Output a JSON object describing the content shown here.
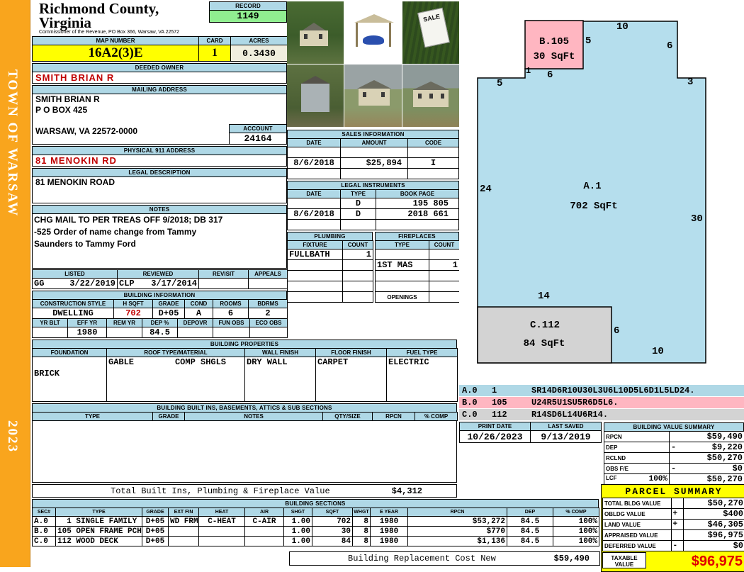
{
  "colors": {
    "accent_blue": "#AFD8E6",
    "record_green": "#90EE90",
    "highlight_yellow": "#FFFF00",
    "alert_red": "#C00000",
    "sidebar_orange": "#F9A51D",
    "sketch_blue": "#B5DEED",
    "sketch_pink": "#FFB6C1",
    "sketch_gray": "#D3D3D3"
  },
  "sidebar": {
    "title": "TOWN OF WARSAW",
    "year": "2023"
  },
  "header": {
    "county": "Richmond County, Virginia",
    "subtitle": "Commissioner of the Revenue, PO Box 366, Warsaw, VA 22572",
    "record_label": "RECORD",
    "record_value": "1149",
    "map_label": "MAP NUMBER",
    "map_value": "16A2(3)E",
    "card_label": "CARD",
    "card_value": "1",
    "acres_label": "ACRES",
    "acres_value": "0.3430"
  },
  "photos": {
    "items": [
      "house-street-view",
      "carport",
      "for-sale-sign",
      "shed",
      "house-front",
      "house-side"
    ],
    "sign_text": "SALE"
  },
  "owner": {
    "deeded_label": "DEEDED OWNER",
    "deeded": "SMITH BRIAN R",
    "mailing_label": "MAILING ADDRESS",
    "mailing_lines": [
      "SMITH BRIAN R",
      "P O BOX 425",
      "",
      "WARSAW, VA 22572-0000"
    ],
    "account_label": "ACCOUNT",
    "account": "24164",
    "physical_label": "PHYSICAL 911 ADDRESS",
    "physical": "81 MENOKIN RD",
    "legal_label": "LEGAL DESCRIPTION",
    "legal": "81 MENOKIN ROAD",
    "notes_label": "NOTES",
    "notes_lines": [
      "CHG MAIL TO PER TREAS OFF 9/2018; DB 317",
      "-525 Order of name change from Tammy",
      "Saunders to Tammy Ford"
    ]
  },
  "review": {
    "columns": [
      "LISTED",
      "REVIEWED",
      "REVISIT",
      "APPEALS"
    ],
    "listed_by": "GG",
    "listed_date": "3/22/2019",
    "reviewed_by": "CLP",
    "reviewed_date": "3/17/2014",
    "revisit": "",
    "appeals": ""
  },
  "building_information": {
    "title": "BUILDING INFORMATION",
    "row1_columns": [
      "CONSTRUCTION STYLE",
      "H SQFT",
      "GRADE",
      "COND",
      "ROOMS",
      "BDRMS"
    ],
    "row1_values": [
      "DWELLING",
      "702",
      "D+05",
      "A",
      "6",
      "2"
    ],
    "row2_columns": [
      "YR BLT",
      "EFF YR",
      "REM YR",
      "DEP %",
      "DEPOVR",
      "FUN OBS",
      "ECO OBS"
    ],
    "row2_values": [
      "",
      "1980",
      "",
      "84.5",
      "",
      "",
      ""
    ]
  },
  "building_properties": {
    "title": "BUILDING PROPERTIES",
    "columns": [
      "FOUNDATION",
      "ROOF TYPE/MATERIAL",
      "WALL FINISH",
      "FLOOR FINISH",
      "FUEL TYPE"
    ],
    "foundation": "BRICK",
    "roof_type": "GABLE",
    "roof_material": "COMP SHGLS",
    "wall_finish": "DRY WALL",
    "floor_finish": "CARPET",
    "fuel_type": "ELECTRIC"
  },
  "built_ins": {
    "title": "BUILDING BUILT INS, BASEMENTS, ATTICS & SUB SECTIONS",
    "columns": [
      "TYPE",
      "GRADE",
      "NOTES",
      "QTY/SIZE",
      "RPCN",
      "% COMP"
    ],
    "total_label": "Total Built Ins, Plumbing & Fireplace Value",
    "total_value": "$4,312"
  },
  "sales": {
    "title": "SALES INFORMATION",
    "columns": [
      "DATE",
      "AMOUNT",
      "CODE"
    ],
    "rows": [
      [
        "",
        "",
        ""
      ],
      [
        "8/6/2018",
        "$25,894",
        "I"
      ],
      [
        "",
        "",
        ""
      ]
    ]
  },
  "legal_instruments": {
    "title": "LEGAL INSTRUMENTS",
    "columns": [
      "DATE",
      "TYPE",
      "BOOK PAGE"
    ],
    "rows": [
      [
        "",
        "D",
        "195 805"
      ],
      [
        "8/6/2018",
        "D",
        "2018 661"
      ],
      [
        "",
        "",
        ""
      ]
    ]
  },
  "plumbing": {
    "title": "PLUMBING",
    "columns": [
      "FIXTURE",
      "COUNT"
    ],
    "rows": [
      [
        "FULLBATH",
        "1"
      ],
      [
        "",
        ""
      ],
      [
        "",
        ""
      ],
      [
        "",
        ""
      ],
      [
        "",
        ""
      ]
    ]
  },
  "fireplaces": {
    "title": "FIREPLACES",
    "columns": [
      "TYPE",
      "COUNT"
    ],
    "rows": [
      [
        "",
        ""
      ],
      [
        "1ST MAS",
        "1"
      ],
      [
        "",
        ""
      ],
      [
        "",
        ""
      ]
    ],
    "openings_label": "OPENINGS",
    "openings_value": ""
  },
  "sketch": {
    "areas": {
      "a_id": "A.1",
      "a_size": "702 SqFt",
      "b_id": "B.105",
      "b_size": "30 SqFt",
      "c_id": "C.112",
      "c_size": "84 SqFt"
    },
    "dims": [
      "10",
      "6",
      "5",
      "3",
      "5",
      "1",
      "6",
      "24",
      "30",
      "14",
      "6",
      "10"
    ],
    "legend": [
      {
        "sec": "A.0",
        "num": "1",
        "code": "SR14D6R10U30L3U6L10D5L6D1L5LD24."
      },
      {
        "sec": "B.0",
        "num": "105",
        "code": "U24R5U1SU5R6D5L6."
      },
      {
        "sec": "C.0",
        "num": "112",
        "code": "R14SD6L14U6R14."
      }
    ]
  },
  "print_info": {
    "print_date_label": "PRINT DATE",
    "print_date": "10/26/2023",
    "last_saved_label": "LAST SAVED",
    "last_saved": "9/13/2019"
  },
  "building_value_summary": {
    "title": "BUILDING VALUE SUMMARY",
    "rows": [
      {
        "label": "RPCN",
        "extra": "",
        "op": "",
        "value": "$59,490"
      },
      {
        "label": "DEP",
        "extra": "",
        "op": "-",
        "value": "$9,220"
      },
      {
        "label": "RCLND",
        "extra": "",
        "op": "",
        "value": "$50,270"
      },
      {
        "label": "OBS F/E",
        "extra": "",
        "op": "-",
        "value": "$0"
      },
      {
        "label": "LCF",
        "extra": "100%",
        "op": "",
        "value": "$50,270"
      }
    ]
  },
  "building_sections": {
    "title": "BUILDING SECTIONS",
    "columns": [
      "SEC#",
      "TYPE",
      "GRADE",
      "EXT FIN",
      "HEAT",
      "AIR",
      "SHGT",
      "SQFT",
      "WHGT",
      "E YEAR",
      "RPCN",
      "DEP",
      "% COMP"
    ],
    "rows": [
      [
        "A.0",
        "  1 SINGLE FAMILY",
        "D+05",
        "WD FRM",
        "C-HEAT",
        "C-AIR",
        "1.00",
        "702",
        "8",
        "1980",
        "$53,272",
        "84.5",
        "100%"
      ],
      [
        "B.0",
        "105 OPEN FRAME PCH",
        "D+05",
        "",
        "",
        "",
        "1.00",
        "30",
        "8",
        "1980",
        "$770",
        "84.5",
        "100%"
      ],
      [
        "C.0",
        "112 WOOD DECK",
        "D+05",
        "",
        "",
        "",
        "1.00",
        "84",
        "8",
        "1980",
        "$1,136",
        "84.5",
        "100%"
      ]
    ]
  },
  "parcel_summary": {
    "title": "PARCEL SUMMARY",
    "rows": [
      {
        "label": "TOTAL BLDG VALUE",
        "op": "",
        "value": "$50,270"
      },
      {
        "label": "OBLDG VALUE",
        "op": "+",
        "value": "$400"
      },
      {
        "label": "LAND VALUE",
        "op": "+",
        "value": "$46,305"
      },
      {
        "label": "APPRAISED VALUE",
        "op": "",
        "value": "$96,975"
      },
      {
        "label": "DEFERRED VALUE",
        "op": "-",
        "value": "$0"
      }
    ],
    "taxable_label": "TAXABLE VALUE",
    "taxable_value": "$96,975"
  },
  "footer": {
    "replacement_label": "Building Replacement Cost New",
    "replacement_value": "$59,490"
  }
}
